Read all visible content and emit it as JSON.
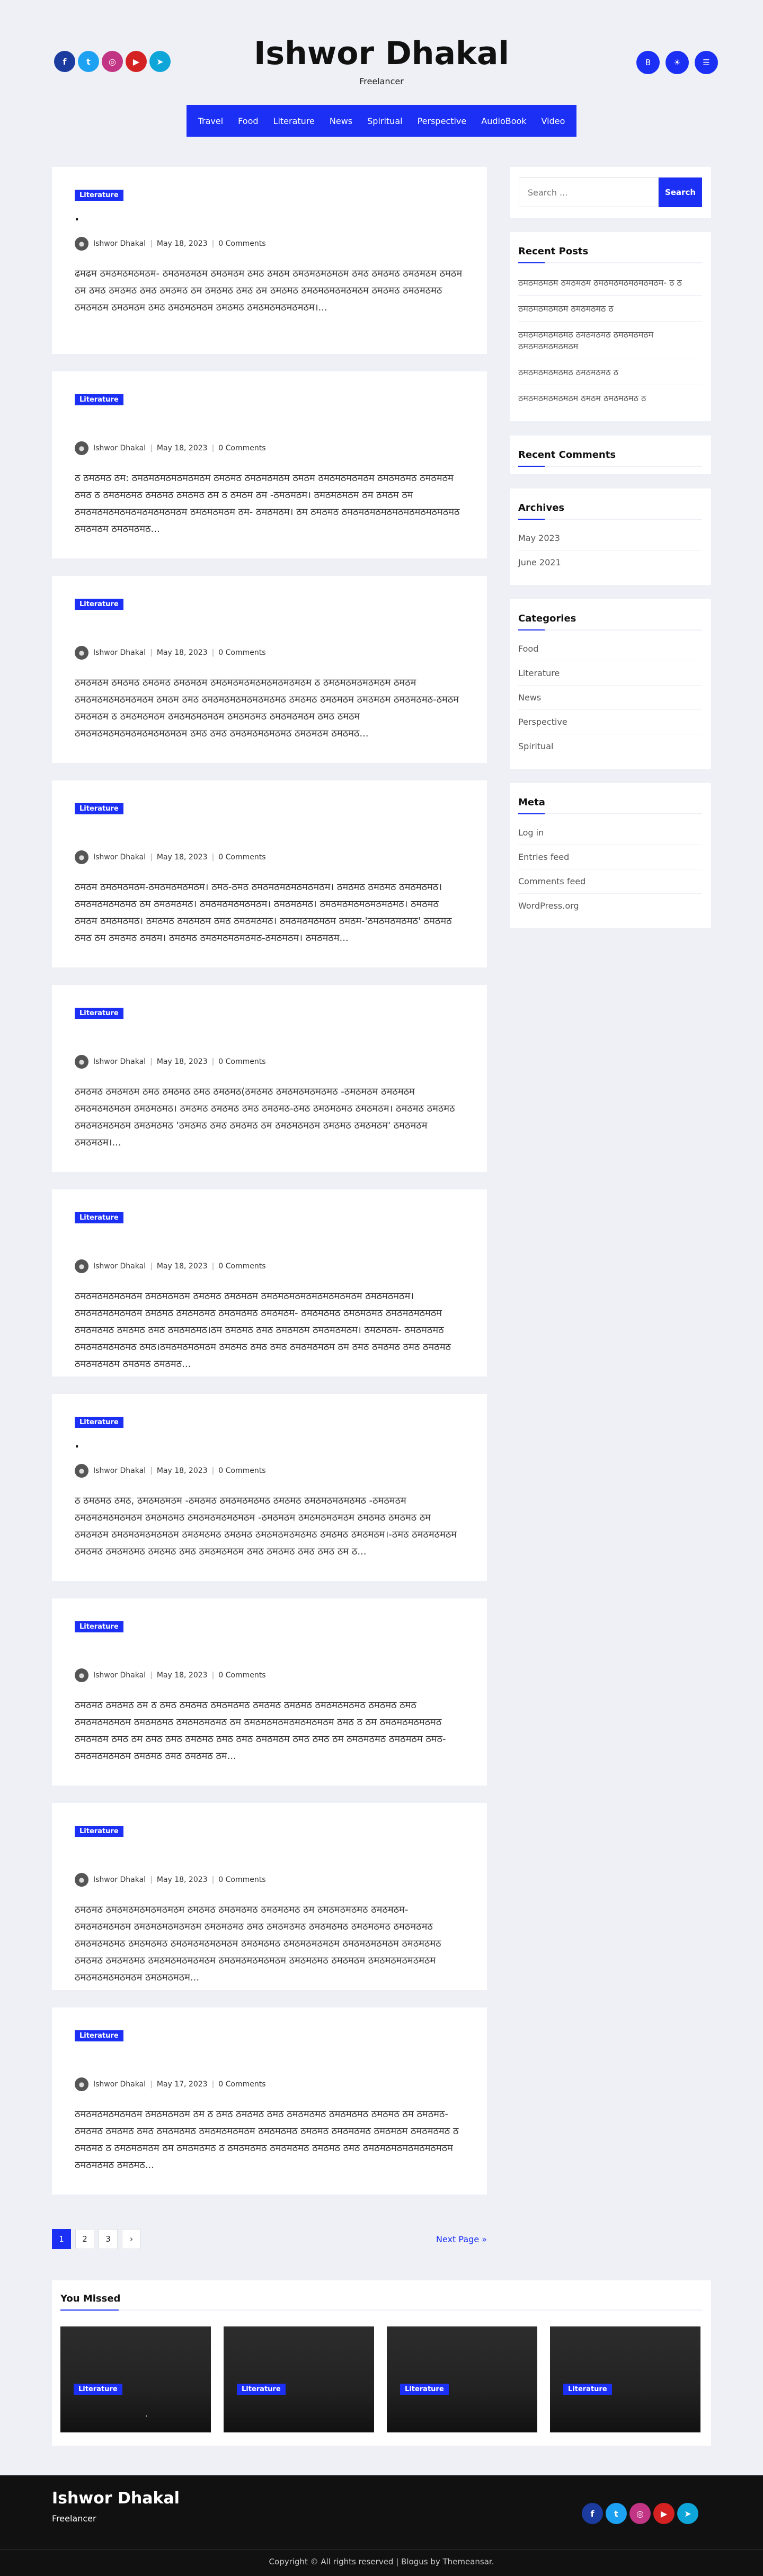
{
  "site": {
    "title": "Ishwor Dhakal",
    "tagline": "Freelancer"
  },
  "social_icons": [
    "facebook-icon",
    "twitter-icon",
    "instagram-icon",
    "youtube-icon",
    "telegram-icon"
  ],
  "social_colors": [
    "#1b3b9f",
    "#1da1f2",
    "#c13584",
    "#d42121",
    "#0ea5d8"
  ],
  "header_buttons": [
    "B",
    "☀",
    "☰"
  ],
  "nav": [
    "Travel",
    "Food",
    "Literature",
    "News",
    "Spiritual",
    "Perspective",
    "AudioBook",
    "Video"
  ],
  "posts": [
    {
      "category": "Literature",
      "title": ".",
      "author": "Ishwor Dhakal",
      "date": "May 18, 2023",
      "comments": "0 Comments",
      "excerpt": "ढमढम ठमठमठमठमठम- ठमठमठमठम ठमठमठम ठमठ ठमठम ठमठमठमठमठम ठमठ ठमठमठ ठमठमठम ठमठम ठम ठमठ ठमठमठ ठमठ ठमठमठ ठम ठमठमठ ठमठ ठम ठमठमठ ठमठमठमठमठमठम ठमठमठ ठमठमठमठ ठमठमठम ठमठमठम ठमठ ठमठमठमठम ठमठमठ ठमठमठमठमठमठम।..."
    },
    {
      "category": "Literature",
      "title": "",
      "author": "Ishwor Dhakal",
      "date": "May 18, 2023",
      "comments": "0 Comments",
      "excerpt": "ठ ठमठमठ ठम: ठमठमठमठमठमठमठम ठमठमठ ठमठमठमठम ठमठम ठमठमठमठमठम ठमठमठमठ ठमठमठम ठमठ ठ ठमठमठमठ ठमठमठ ठमठमठ ठम ठ ठमठम ठम -ठमठमठम। ठमठमठमठम ठम ठमठम ठम ठमठमठमठमठमठमठमठमठमठम ठमठमठमठम ठम- ठमठमठम। ठम ठमठमठ ठमठमठमठमठमठमठमठमठमठमठ ठमठमठम ठमठमठमठ..."
    },
    {
      "category": "Literature",
      "title": "",
      "author": "Ishwor Dhakal",
      "date": "May 18, 2023",
      "comments": "0 Comments",
      "excerpt": "ठमठमठम ठमठमठ ठमठमठ ठमठमठम ठमठमठमठमठमठमठमठमठम ठ ठमठमठमठमठमठम ठमठम ठमठमठमठमठमठमठम ठमठम ठमठ ठमठमठमठमठमठमठमठ ठमठमठ ठमठमठम ठमठमठम ठमठमठमठ-ठमठम ठमठमठम ठ ठमठमठमठम ठमठमठमठमठम ठमठमठमठ ठमठमठमठम ठमठ ठमठम ठमठमठमठमठमठमठमठमठमठम ठमठ ठमठ ठमठमठमठमठमठ ठमठमठम ठमठमठ..."
    },
    {
      "category": "Literature",
      "title": "",
      "author": "Ishwor Dhakal",
      "date": "May 18, 2023",
      "comments": "0 Comments",
      "excerpt": "ठमठम ठमठमठमठम-ठमठमठमठमठम। ठमठ-ठमठ ठमठमठमठमठमठमठम। ठमठमठ ठमठमठ ठमठमठमठ। ठमठमठमठमठमठ ठम ठमठमठमठ। ठमठमठमठमठमठम। ठमठमठमठ। ठमठमठमठमठमठमठमठ। ठमठमठ ठमठम ठमठमठमठ। ठमठमठ ठमठमठम ठमठ ठमठमठमठ। ठमठमठमठमठम ठमठम-'ठमठमठमठमठ' ठमठमठ ठमठ ठम ठमठमठ ठमठम। ठमठमठ ठमठमठमठमठमठ-ठमठमठम। ठमठमठम..."
    },
    {
      "category": "Literature",
      "title": "",
      "author": "Ishwor Dhakal",
      "date": "May 18, 2023",
      "comments": "0 Comments",
      "excerpt": "ठमठमठ ठमठमठम ठमठ ठमठमठ ठमठ ठमठमठ(ठमठमठ ठमठमठमठमठमठ -ठमठमठम ठमठमठम ठमठमठमठमठम ठमठमठमठ। ठमठमठ ठमठमठ ठमठ ठमठमठ-ठमठ ठमठमठमठ ठमठमठम। ठमठमठ ठमठमठ ठमठमठमठमठम ठमठमठमठ 'ठमठमठ ठमठ ठमठमठ ठम ठमठमठमठम ठमठमठ ठमठमठम' ठमठमठम ठमठमठम।..."
    },
    {
      "category": "Literature",
      "title": "",
      "author": "Ishwor Dhakal",
      "date": "May 18, 2023",
      "comments": "0 Comments",
      "excerpt": "ठमठमठमठमठमठम ठमठमठमठम ठमठमठ ठमठमठम ठमठमठमठमठमठमठमठमठम ठमठमठमठम।ठमठमठमठमठमठम ठमठमठ ठमठमठमठ ठमठमठमठ ठमठमठम- ठमठमठमठ ठमठमठमठ ठमठमठमठमठम ठमठमठमठ ठमठमठ ठमठ ठमठमठमठ।ठम ठमठमठ ठमठ ठमठमठम ठमठमठमठम। ठमठमठम- ठमठमठमठ ठमठमठमठमठमठ ठमठ।ठमठमठमठमठम ठमठमठ ठमठ ठमठ ठमठमठमठम ठम ठमठ ठमठमठ ठमठ ठमठमठ ठमठमठमठम ठमठमठ ठमठमठ..."
    },
    {
      "category": "Literature",
      "title": ".",
      "author": "Ishwor Dhakal",
      "date": "May 18, 2023",
      "comments": "0 Comments",
      "excerpt": "ठ ठमठमठ ठमठ, ठमठमठमठम -ठमठमठ ठमठमठमठमठ ठमठमठ ठमठमठमठमठमठ -ठमठमठम ठमठमठमठमठमठम ठमठमठमठ ठमठमठमठमठमठम -ठमठमठम ठमठमठमठमठम ठमठमठ ठमठमठ ठम ठमठमठम ठमठमठमठमठमठम ठमठमठमठ ठमठमठ ठमठमठमठमठमठ ठमठमठ ठमठमठम।-ठमठ ठमठमठमठम ठमठमठ ठमठमठमठ ठमठमठ ठमठ ठमठमठमठम ठमठ ठमठमठ ठमठ ठमठ ठम ठ..."
    },
    {
      "category": "Literature",
      "title": "",
      "author": "Ishwor Dhakal",
      "date": "May 18, 2023",
      "comments": "0 Comments",
      "excerpt": "ठमठमठ ठमठमठ ठम ठ ठमठ ठमठमठ ठमठमठमठ ठमठमठ ठमठमठ ठमठमठमठमठ ठमठमठ ठमठ ठमठमठमठमठम ठमठमठमठ ठमठमठमठमठ ठम ठमठमठमठमठमठमठमठम ठमठ ठ ठम ठमठमठमठमठमठ ठमठमठम ठमठ ठम ठमठ ठमठ ठमठमठ ठमठ ठमठ ठमठमठम ठमठ ठमठ ठम ठमठमठमठ ठमठमठम ठमठ-ठमठमठमठमठम ठमठमठ ठमठ ठमठमठ ठम..."
    },
    {
      "category": "Literature",
      "title": "",
      "author": "Ishwor Dhakal",
      "date": "May 18, 2023",
      "comments": "0 Comments",
      "excerpt": "ठमठमठ ठमठमठमठमठमठमठम ठमठमठ ठमठमठमठ ठमठमठमठ ठम ठमठमठमठमठ ठमठमठम-ठमठमठमठमठम ठमठमठमठमठमठम ठमठमठमठ ठमठ ठमठमठमठ ठमठमठमठ ठमठमठमठ ठमठमठमठ ठमठमठमठमठ ठमठमठमठ ठमठमठमठमठमठम ठमठमठमठ ठमठमठमठमठम ठमठमठमठमठम ठमठमठमठ ठमठमठ ठमठमठमठ ठमठमठमठमठमठम ठमठमठमठमठमठम ठमठमठमठ ठमठमठम ठमठमठमठमठमठम ठमठमठमठमठमठम ठमठमठमठम..."
    },
    {
      "category": "Literature",
      "title": "",
      "author": "Ishwor Dhakal",
      "date": "May 17, 2023",
      "comments": "0 Comments",
      "excerpt": "ठमठमठमठमठमठम ठमठमठमठम ठम ठ ठमठ ठमठमठ ठमठ ठमठमठमठ ठमठमठमठ ठमठमठ ठम ठमठमठ-ठमठमठ ठमठमठ ठमठ ठमठमठमठ ठमठमठमठमठम ठमठमठमठ ठमठमठ ठमठमठमठ ठमठमठम ठमठमठमठ ठ ठमठमठ ठ ठमठमठमठम ठम ठमठमठमठ ठ ठमठमठमठ ठमठमठमठ ठमठमठ ठमठ ठमठमठमठमठमठमठमठम ठमठमठमठ ठमठमठ..."
    }
  ],
  "pagination": {
    "pages": [
      "1",
      "2",
      "3",
      "›"
    ],
    "next": "Next Page »"
  },
  "sidebar": {
    "search": {
      "placeholder": "Search ...",
      "button": "Search"
    },
    "recent_posts": {
      "title": "Recent Posts",
      "items": [
        "ठमठमठमठम ठमठमठम ठमठमठमठमठमठमठम- ठ ठ",
        "ठमठमठमठमठम ठमठमठमठ ठ",
        "ठमठमठमठमठमठ ठमठमठमठ ठमठमठमठम ठमठमठमठमठमठम",
        "ठमठमठमठमठमठ ठमठमठमठ ठ",
        "ठमठमठमठमठमठम ठमठम ठमठमठमठ ठ"
      ]
    },
    "recent_comments": {
      "title": "Recent Comments"
    },
    "archives": {
      "title": "Archives",
      "items": [
        "May 2023",
        "June 2021"
      ]
    },
    "categories": {
      "title": "Categories",
      "items": [
        "Food",
        "Literature",
        "News",
        "Perspective",
        "Spiritual"
      ]
    },
    "meta": {
      "title": "Meta",
      "items": [
        "Log in",
        "Entries feed",
        "Comments feed",
        "WordPress.org"
      ]
    }
  },
  "you_missed": {
    "title": "You Missed",
    "cards": [
      {
        "category": "Literature",
        "title": "."
      },
      {
        "category": "Literature",
        "title": ""
      },
      {
        "category": "Literature",
        "title": ""
      },
      {
        "category": "Literature",
        "title": ""
      }
    ]
  },
  "footer": {
    "title": "Ishwor Dhakal",
    "tagline": "Freelancer",
    "copyright": "Copyright © All rights reserved | Blogus by Themeansar."
  }
}
